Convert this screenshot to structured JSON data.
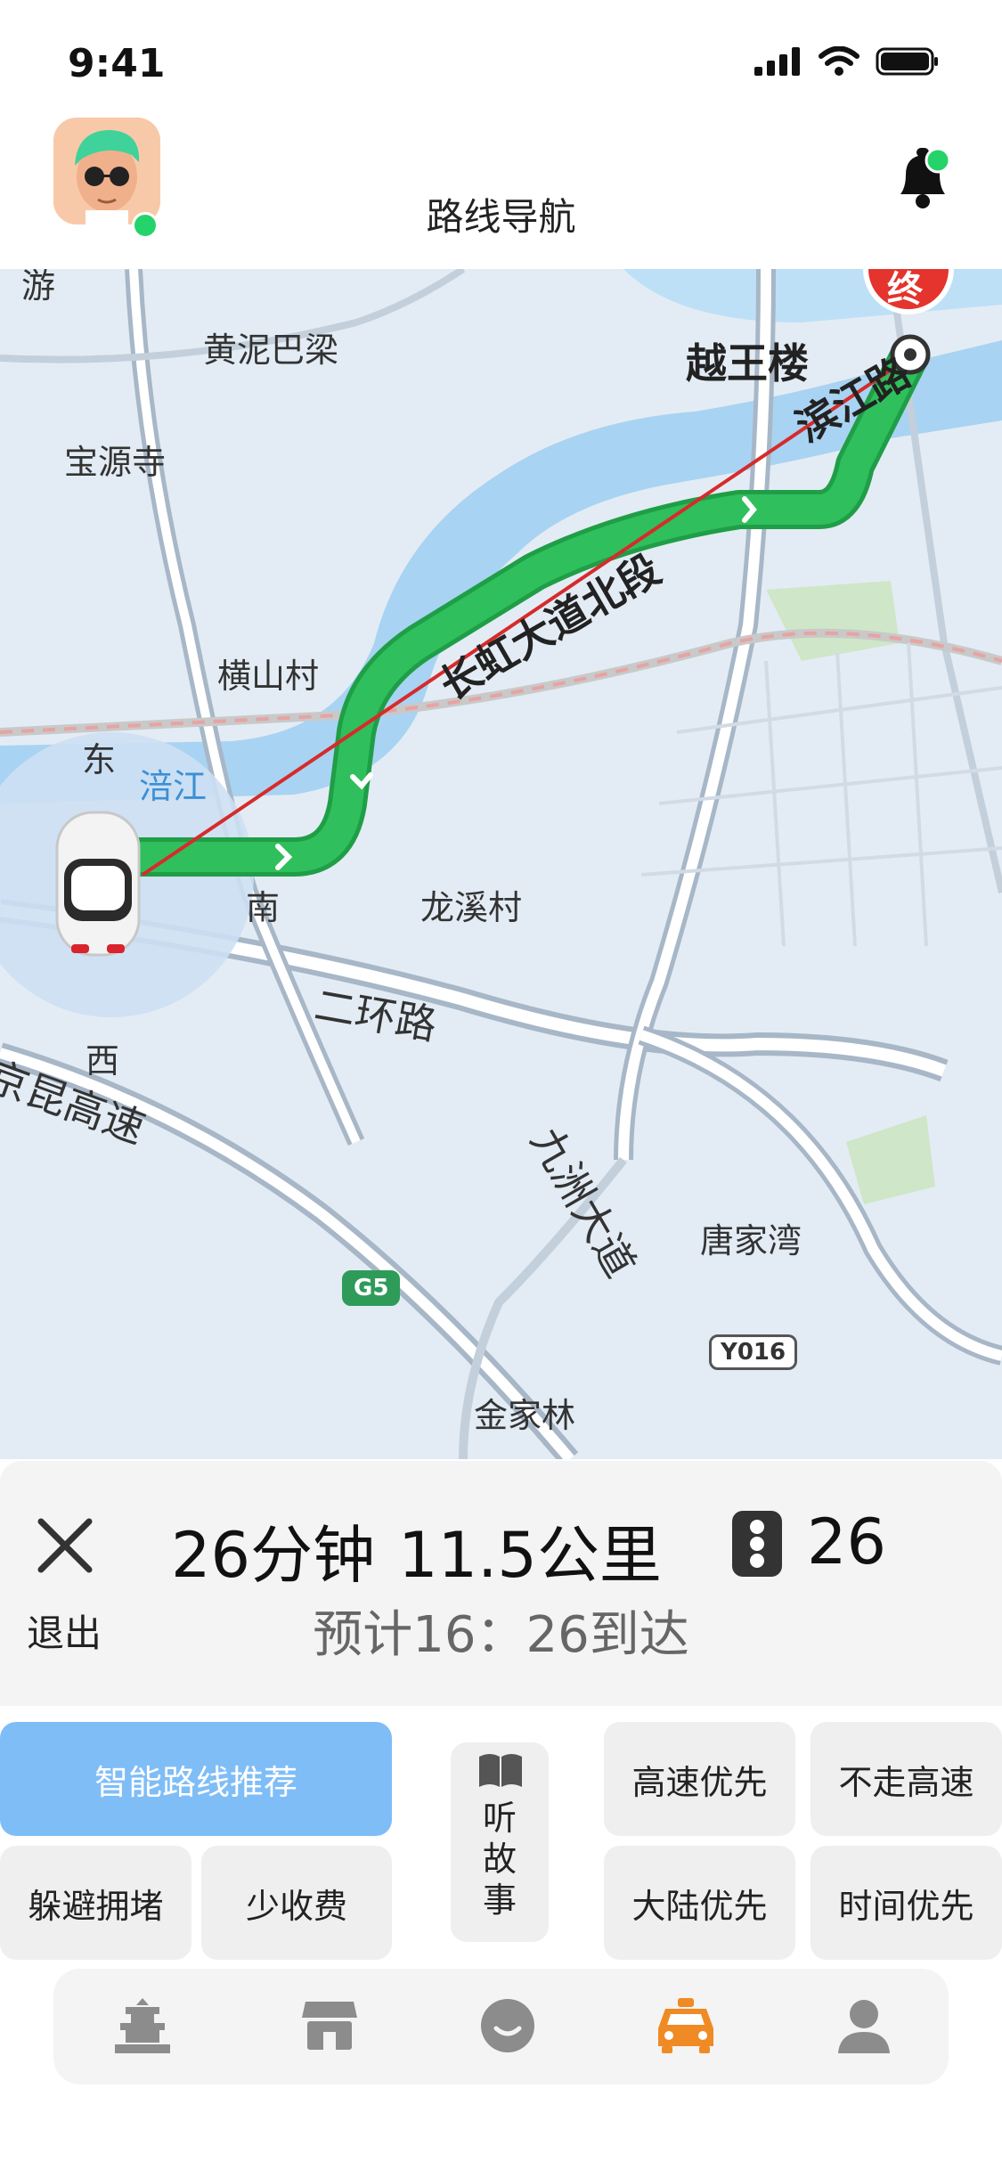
{
  "status_bar": {
    "time": "9:41"
  },
  "header": {
    "title": "路线导航"
  },
  "map": {
    "labels": {
      "huangni": "黄泥巴梁",
      "baoyuan": "宝源寺",
      "yuewang": "越王楼",
      "binjiang": "滨江路",
      "changhong": "长虹大道北段",
      "hengshan": "横山村",
      "east": "东",
      "fujiang": "涪江",
      "south": "南",
      "longxi": "龙溪村",
      "erhuan": "二环路",
      "west": "西",
      "jingkun": "京昆高速",
      "jiuzhou": "九洲大道",
      "tangjia": "唐家湾",
      "jinjia": "金家林",
      "top_partial": "游"
    },
    "badges": {
      "g5": "G5",
      "y016": "Y016"
    },
    "end_marker": "终"
  },
  "nav": {
    "exit_label": "退出",
    "duration": "26分钟",
    "distance": "11.5公里",
    "light_count": "26",
    "eta": "预计16：26到达"
  },
  "route_options": {
    "smart": "智能路线推荐",
    "avoid_congestion": "躲避拥堵",
    "less_toll": "少收费",
    "story": "听故事",
    "highway_first": "高速优先",
    "no_highway": "不走高速",
    "mainland_first": "大陆优先",
    "time_first": "时间优先"
  },
  "colors": {
    "accent_blue": "#7fbdf7",
    "route_green": "#2fbf5c",
    "tab_active": "#f08a24",
    "tab_inactive": "#8c8c8c"
  },
  "tabs": [
    {
      "icon": "temple-icon"
    },
    {
      "icon": "shop-icon"
    },
    {
      "icon": "smile-icon"
    },
    {
      "icon": "taxi-icon",
      "active": true
    },
    {
      "icon": "user-icon"
    }
  ]
}
